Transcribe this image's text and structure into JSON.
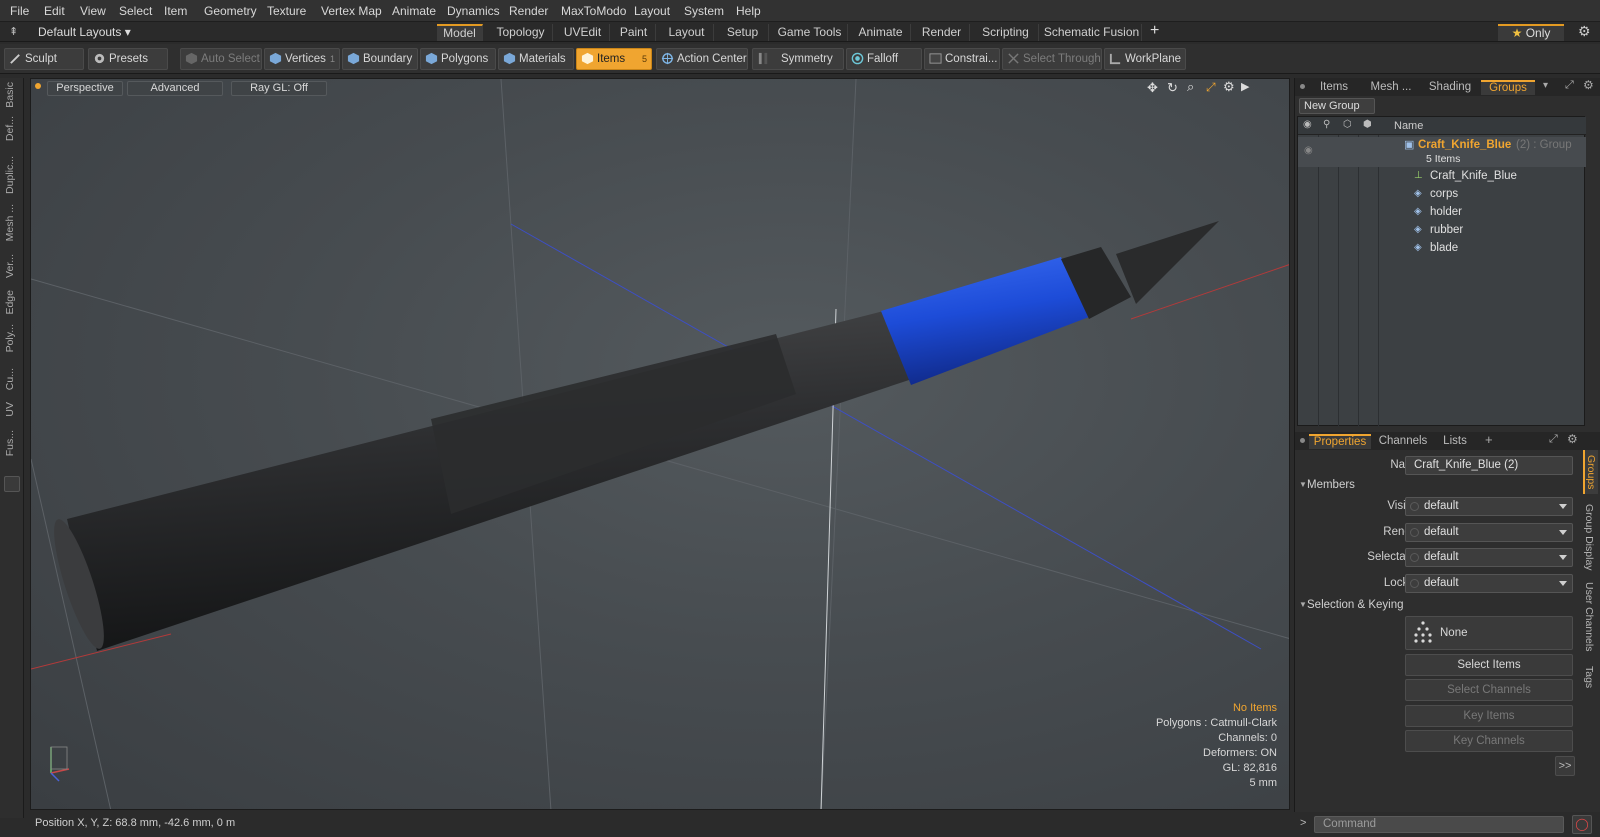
{
  "menu": {
    "items": [
      "File",
      "Edit",
      "View",
      "Select",
      "Item",
      "Geometry",
      "Texture",
      "Vertex Map",
      "Animate",
      "Dynamics",
      "Render",
      "MaxToModo",
      "Layout",
      "System",
      "Help"
    ]
  },
  "layouts": {
    "selector": "Default Layouts ▾",
    "tabs": [
      "Model",
      "Topology",
      "UVEdit",
      "Paint",
      "Layout",
      "Setup",
      "Game Tools",
      "Animate",
      "Render",
      "Scripting",
      "Schematic Fusion"
    ],
    "active_tab": "Model",
    "only_label": "Only"
  },
  "toolbar": {
    "sculpt": "Sculpt",
    "presets": "Presets",
    "auto_select": "Auto Select",
    "vertices": "Vertices",
    "vertices_count": "1",
    "boundary": "Boundary",
    "polygons": "Polygons",
    "materials": "Materials",
    "items": "Items",
    "items_count": "5",
    "action_center": "Action Center",
    "symmetry": "Symmetry",
    "falloff": "Falloff",
    "constraints": "Constrai...",
    "select_through": "Select Through",
    "workplane": "WorkPlane"
  },
  "left_strip": [
    "Basic",
    "Def...",
    "Duplic...",
    "Mesh ...",
    "Ver...",
    "Edge",
    "Poly...",
    "Cu...",
    "UV",
    "Fus..."
  ],
  "viewport": {
    "mode": "Perspective",
    "advanced": "Advanced",
    "raygl": "Ray GL: Off",
    "info": {
      "no_items": "No Items",
      "polygons": "Polygons : Catmull-Clark",
      "channels": "Channels: 0",
      "deformers": "Deformers: ON",
      "gl": "GL: 82,816",
      "scale": "5 mm"
    }
  },
  "status": {
    "position": "Position X, Y, Z:  68.8 mm, -42.6 mm, 0 m"
  },
  "top_panel": {
    "tabs": [
      "Items",
      "Mesh ...",
      "Shading",
      "Groups"
    ],
    "active_tab": "Groups",
    "new_group": "New Group",
    "col_name": "Name",
    "group": {
      "name": "Craft_Knife_Blue",
      "suffix": "(2) : Group",
      "count": "5 Items"
    },
    "children": [
      "Craft_Knife_Blue",
      "corps",
      "holder",
      "rubber",
      "blade"
    ]
  },
  "properties": {
    "tabs": [
      "Properties",
      "Channels",
      "Lists"
    ],
    "active_tab": "Properties",
    "name_label": "Name",
    "name_value": "Craft_Knife_Blue (2)",
    "members_section": "Members",
    "fields": [
      {
        "label": "Visible",
        "value": "default"
      },
      {
        "label": "Render",
        "value": "default"
      },
      {
        "label": "Selectable",
        "value": "default"
      },
      {
        "label": "Locked",
        "value": "default"
      }
    ],
    "selection_section": "Selection & Keying",
    "none_btn": "None",
    "select_items": "Select Items",
    "select_channels": "Select Channels",
    "key_items": "Key Items",
    "key_channels": "Key Channels",
    "more": ">>",
    "side_tabs": [
      "Groups",
      "Group Display",
      "User Channels",
      "Tags"
    ]
  },
  "command": {
    "placeholder": "Command"
  },
  "colors": {
    "accent": "#f0a530",
    "viewport_bg": "#4a4f53",
    "knife_blue": "#1f4fd6",
    "knife_body": "#2b2c2e"
  }
}
